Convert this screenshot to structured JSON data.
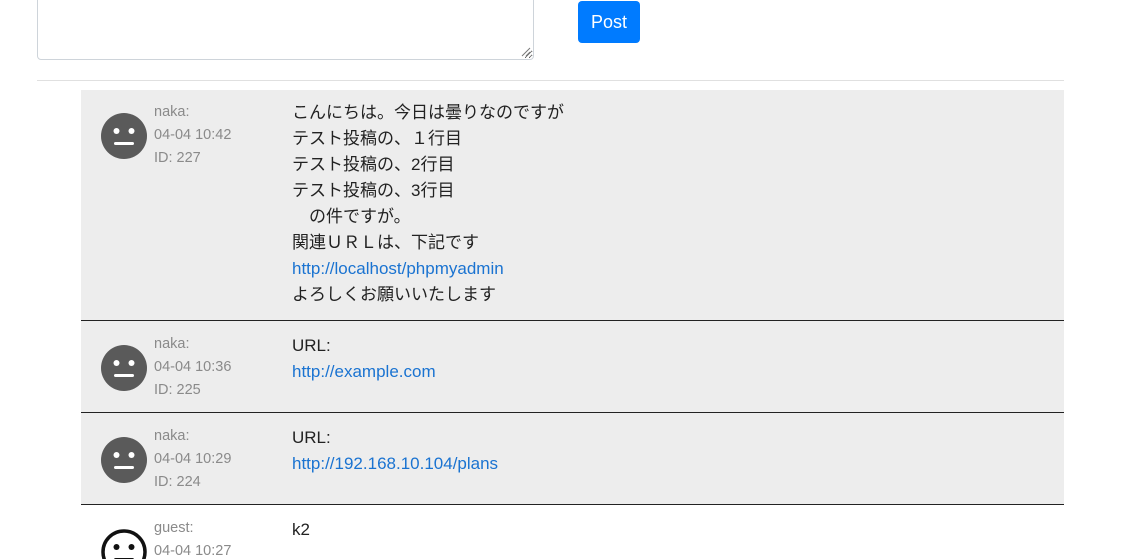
{
  "composer": {
    "textarea_value": "",
    "post_label": "Post"
  },
  "posts": [
    {
      "author": "naka:",
      "time": "04-04 10:42",
      "id": "ID: 227",
      "lines": [
        "こんにちは。今日は曇りなのですが",
        "テスト投稿の、１行目",
        "テスト投稿の、2行目",
        "テスト投稿の、3行目",
        "　の件ですが。",
        "関連ＵＲＬは、下記です"
      ],
      "link": "http://localhost/phpmyadmin",
      "closing": "よろしくお願いいたします",
      "avatar": "neutral-face-filled-icon"
    },
    {
      "author": "naka:",
      "time": "04-04 10:36",
      "id": "ID: 225",
      "text": "URL:",
      "link": "http://example.com",
      "avatar": "neutral-face-filled-icon"
    },
    {
      "author": "naka:",
      "time": "04-04 10:29",
      "id": "ID: 224",
      "text": "URL:",
      "link": "http://192.168.10.104/plans",
      "avatar": "neutral-face-filled-icon"
    },
    {
      "author": "guest:",
      "time": "04-04 10:27",
      "text": "k2",
      "avatar": "neutral-face-outline-icon"
    }
  ],
  "colors": {
    "accent": "#007bff",
    "link": "#1a73d1",
    "post_bg": "#ededed",
    "avatar": "#5a5a5a"
  }
}
